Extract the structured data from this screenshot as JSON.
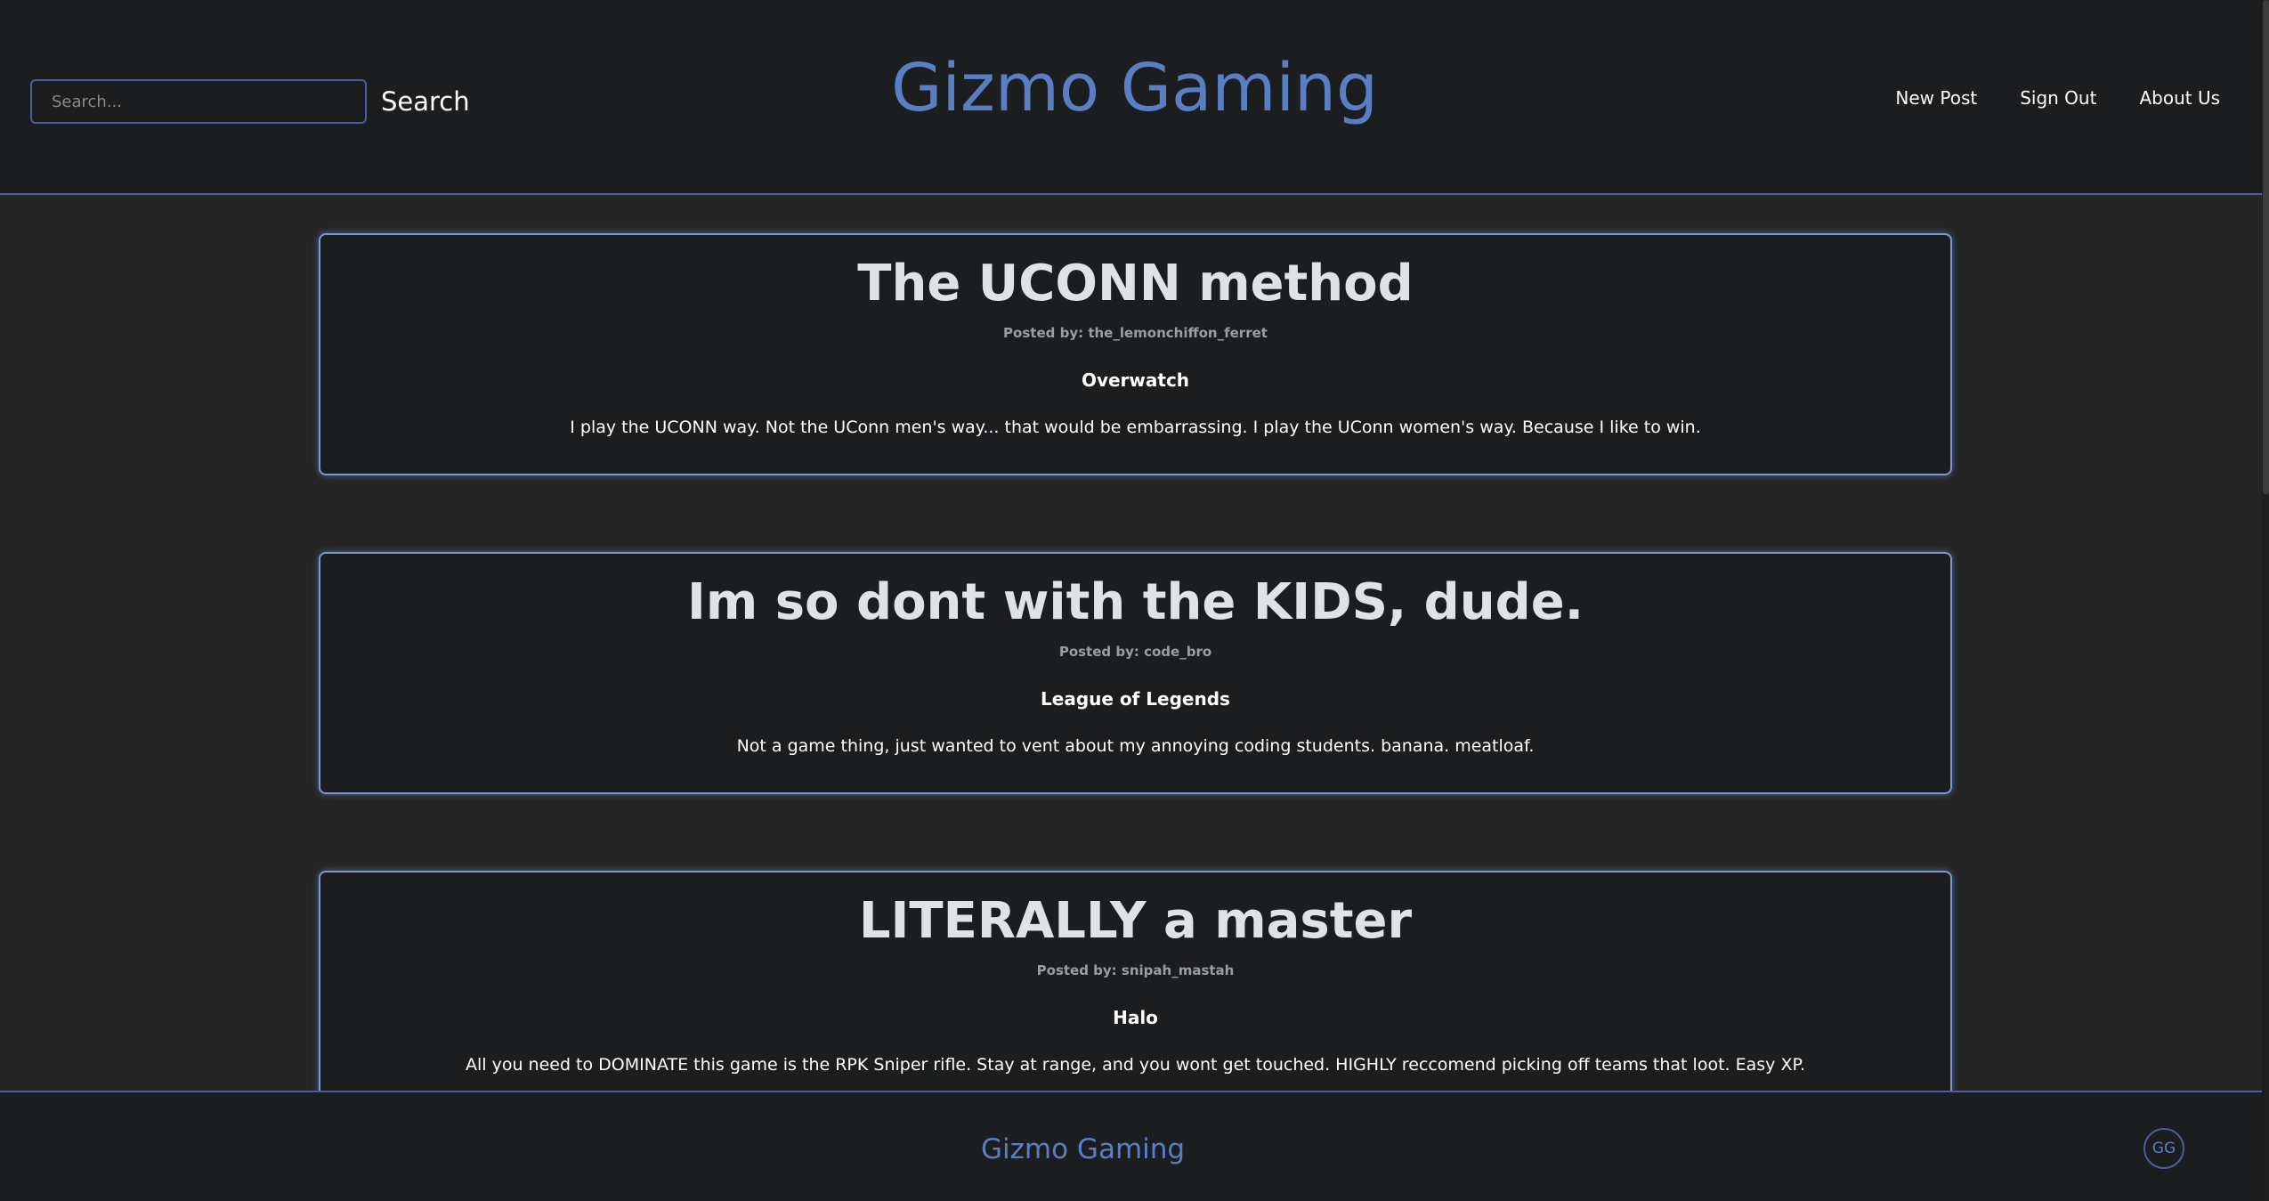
{
  "header": {
    "search_placeholder": "Search...",
    "search_label": "Search",
    "site_title": "Gizmo Gaming",
    "nav": [
      "New Post",
      "Sign Out",
      "About Us"
    ]
  },
  "posts": [
    {
      "title": "The UCONN method",
      "author": "Posted by: the_lemonchiffon_ferret",
      "game": "Overwatch",
      "body": "I play the UCONN way. Not the UConn men's way... that would be embarrassing. I play the UConn women's way. Because I like to win."
    },
    {
      "title": "Im so dont with the KIDS, dude.",
      "author": "Posted by: code_bro",
      "game": "League of Legends",
      "body": "Not a game thing, just wanted to vent about my annoying coding students. banana. meatloaf."
    },
    {
      "title": "LITERALLY a master",
      "author": "Posted by: snipah_mastah",
      "game": "Halo",
      "body": "All you need to DOMINATE this game is the RPK Sniper rifle. Stay at range, and you wont get touched. HIGHLY reccomend picking off teams that loot. Easy XP."
    }
  ],
  "footer": {
    "title": "Gizmo Gaming",
    "badge": "GG"
  },
  "colors": {
    "accent": "#5a7ec4",
    "border": "#7c97d4",
    "background": "#252525",
    "panel": "#1c1d1f"
  }
}
